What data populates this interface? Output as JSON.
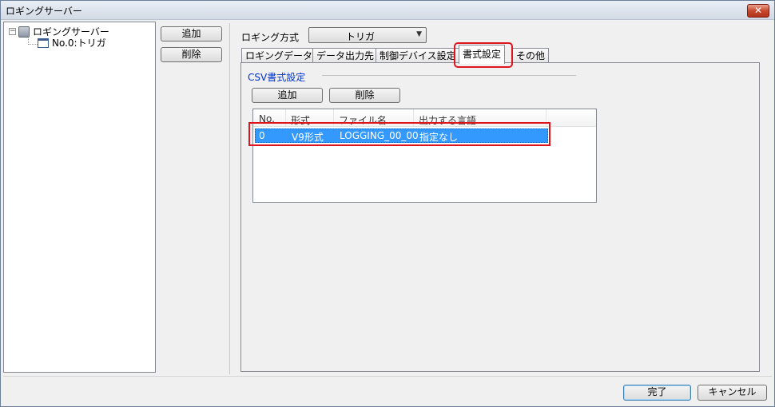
{
  "window": {
    "title": "ロギングサーバー",
    "close_glyph": "✕"
  },
  "tree": {
    "root_label": "ロギングサーバー",
    "root_toggle": "−",
    "child_label": "No.0:トリガ"
  },
  "side_buttons": {
    "add": "追加",
    "delete": "削除"
  },
  "logging_method": {
    "label": "ロギング方式",
    "value": "トリガ",
    "arrow": "▼"
  },
  "tabs": [
    {
      "label": "ロギングデータ",
      "active": false
    },
    {
      "label": "データ出力先",
      "active": false
    },
    {
      "label": "制御デバイス設定",
      "active": false
    },
    {
      "label": "書式設定",
      "active": true
    },
    {
      "label": "その他",
      "active": false
    }
  ],
  "csv_section": {
    "title": "CSV書式設定",
    "add_button": "追加",
    "delete_button": "削除",
    "columns": [
      "No.",
      "形式",
      "ファイル名",
      "出力する言語"
    ],
    "rows": [
      {
        "no": "0",
        "format": "V9形式",
        "filename": "LOGGING_00_00",
        "language": "指定なし",
        "selected": true
      }
    ]
  },
  "footer": {
    "ok_button": "完了",
    "cancel_button": "キャンセル"
  },
  "colors": {
    "selection": "#3399ff",
    "highlight_annotation": "#e0141e",
    "group_title": "#0033cc"
  }
}
